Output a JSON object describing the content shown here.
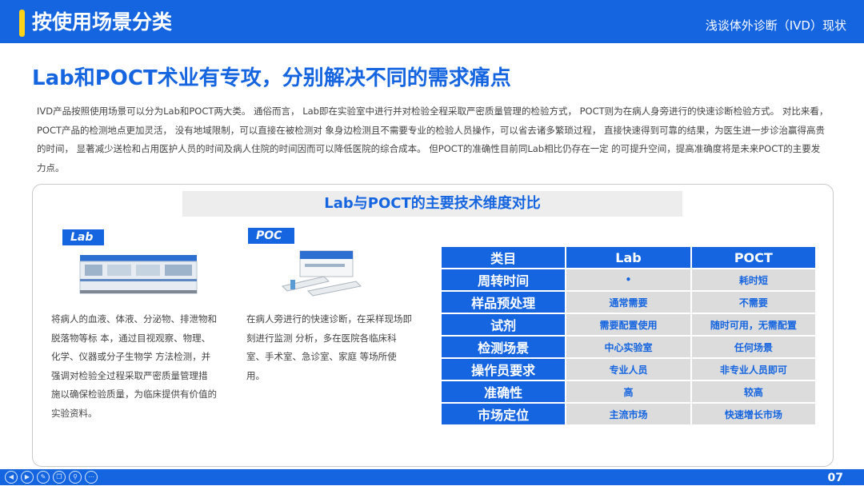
{
  "header": {
    "title": "按使用场景分类",
    "subtitle": "浅谈体外诊断（IVD）现状"
  },
  "headline": "Lab和POCT术业有专攻，分别解决不同的需求痛点",
  "intro": "IVD产品按照使用场景可以分为Lab和POCT两大类。 通俗而言， Lab即在实验室中进行并对检验全程采取严密质量管理的检验方式，   POCT则为在病人身旁进行的快速诊断检验方式。 对比来看， POCT产品的检测地点更加灵活， 没有地域限制，可以直接在被检测对  象身边检测且不需要专业的检验人员操作，可以省去诸多繁琐过程， 直接快速得到可靠的结果，为医生进一步诊治赢得高贵的时间， 显著减少送检和占用医护人员的时间及病人住院的时间因而可以降低医院的综合成本。 但POCT的准确性目前同Lab相比仍存在一定  的可提升空间，提高准确度将是未来POCT的主要发力点。",
  "panel": {
    "title": "Lab与POCT的主要技术维度对比",
    "lab_tag": "Lab",
    "poc_tag": "POC",
    "lab_desc": "将病人的血液、体液、分泌物、排泄物和脱落物等标 本，通过目视观察、物理、化学、仪器或分子生物学 方法检测，并强调对检验全过程采取严密质量管理措 施以确保检验质量，为临床提供有价值的实验资料。",
    "poc_desc": "在病人旁进行的快速诊断，在采样现场即刻进行监测 分析，多在医院各临床科室、手术室、急诊室、家庭 等场所使用。"
  },
  "table": {
    "headers": [
      "类目",
      "Lab",
      "POCT"
    ],
    "rows": [
      [
        "周转时间",
        "•",
        "耗时短"
      ],
      [
        "样品预处理",
        "通常需要",
        "不需要"
      ],
      [
        "试剂",
        "需要配置使用",
        "随时可用，无需配置"
      ],
      [
        "检测场景",
        "中心实验室",
        "任何场景"
      ],
      [
        "操作员要求",
        "专业人员",
        "非专业人员即可"
      ],
      [
        "准确性",
        "高",
        "较高"
      ],
      [
        "市场定位",
        "主流市场",
        "快速增长市场"
      ]
    ]
  },
  "footer": {
    "page": "07"
  },
  "colors": {
    "primary": "#1565e0",
    "accent": "#ffd21a",
    "cell": "#dcdcdc"
  }
}
